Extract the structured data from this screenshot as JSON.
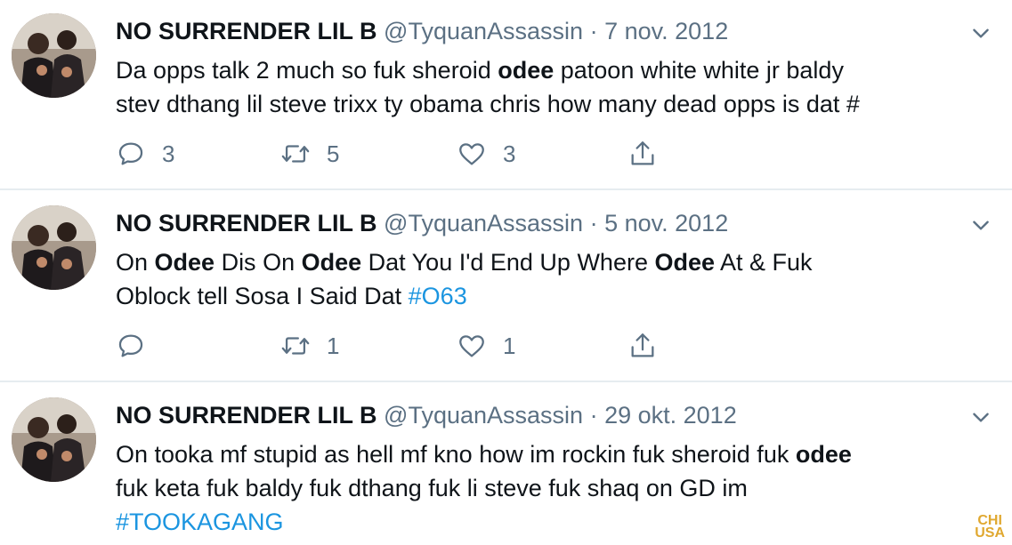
{
  "tweets": [
    {
      "name": "NO SURRENDER LIL B",
      "handle": "@TyquanAssassin",
      "separator": "·",
      "date": "7 nov. 2012",
      "text": {
        "line1_a": "Da opps talk 2 much so fuk sheroid ",
        "line1_b": "odee",
        "line1_c": " patoon white white jr baldy",
        "line2_a": "stev dthang lil steve trixx ty obama chris how many dead opps is dat #"
      },
      "reply_count": "3",
      "retweet_count": "5",
      "like_count": "3"
    },
    {
      "name": "NO SURRENDER LIL B",
      "handle": "@TyquanAssassin",
      "separator": "·",
      "date": "5 nov. 2012",
      "text": {
        "line1_a": "On ",
        "line1_b": "Odee",
        "line1_c": " Dis On ",
        "line1_d": "Odee",
        "line1_e": " Dat You I'd End Up Where ",
        "line1_f": "Odee",
        "line1_g": " At & Fuk",
        "line2_a": "Oblock tell Sosa I Said Dat ",
        "line2_hashtag": "#O63"
      },
      "reply_count": "",
      "retweet_count": "1",
      "like_count": "1"
    },
    {
      "name": "NO SURRENDER LIL B",
      "handle": "@TyquanAssassin",
      "separator": "·",
      "date": "29 okt. 2012",
      "text": {
        "line1_a": "On tooka mf stupid as hell mf kno how im rockin fuk sheroid fuk ",
        "line1_b": "odee",
        "line2_a": "fuk keta fuk baldy fuk dthang fuk li steve fuk shaq on GD im",
        "line3_hashtag": "#TOOKAGANG"
      }
    }
  ],
  "watermark": {
    "line1": "CHI",
    "line2": "USA"
  },
  "icons": [
    "reply-icon",
    "retweet-icon",
    "like-icon",
    "share-icon",
    "chevron-down-icon"
  ],
  "colors": {
    "text": "#0f1419",
    "secondary": "#5b7083",
    "hashtag": "#1b95e0",
    "divider": "#e6ecf0"
  }
}
